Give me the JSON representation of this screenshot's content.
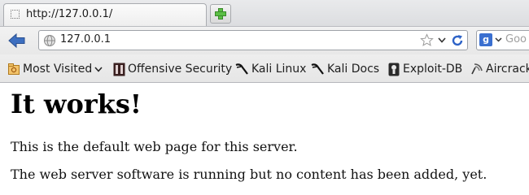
{
  "tab": {
    "title": "http://127.0.0.1/"
  },
  "navbar": {
    "url": "127.0.0.1",
    "search_placeholder": "Goo"
  },
  "bookmarks": [
    {
      "label": "Most Visited",
      "icon": "most-visited-icon"
    },
    {
      "label": "Offensive Security",
      "icon": "offensive-security-icon"
    },
    {
      "label": "Kali Linux",
      "icon": "kali-dragon-icon"
    },
    {
      "label": "Kali Docs",
      "icon": "kali-dragon-icon"
    },
    {
      "label": "Exploit-DB",
      "icon": "exploit-db-icon"
    },
    {
      "label": "Aircrack",
      "icon": "aircrack-icon"
    }
  ],
  "page": {
    "heading": "It works!",
    "paragraphs": [
      "This is the default web page for this server.",
      "The web server software is running but no content has been added, yet."
    ]
  },
  "colors": {
    "back_arrow": "#3d6fc0",
    "reload": "#2e63c7",
    "add_tab": "#4caf3c"
  }
}
